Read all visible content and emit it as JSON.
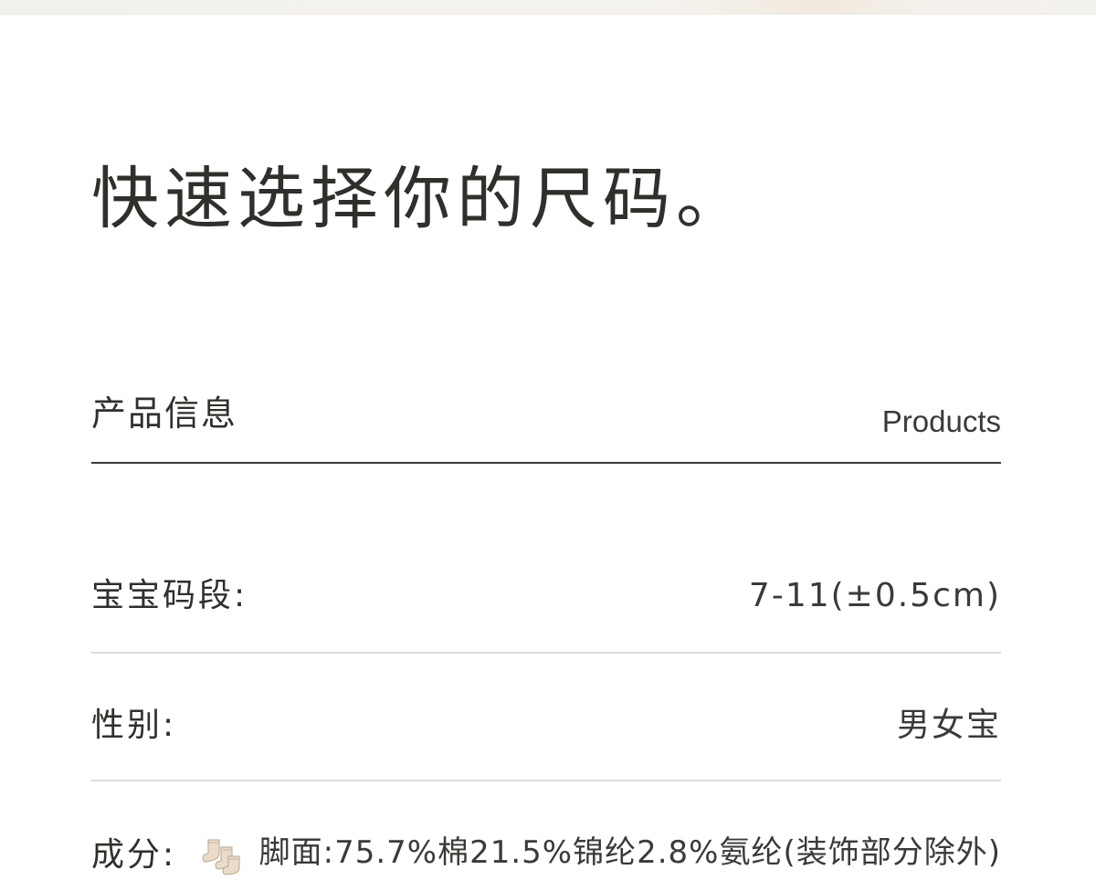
{
  "page": {
    "title": "快速选择你的尺码。"
  },
  "section": {
    "title_cn": "产品信息",
    "title_en": "Products"
  },
  "specs": [
    {
      "label": "宝宝码段:",
      "value": "7-11(±0.5cm)"
    },
    {
      "label": "性别:",
      "value": "男女宝"
    },
    {
      "label": "成分:",
      "icon": "sock-icon",
      "value": "脚面:75.7%棉21.5%锦纶2.8%氨纶(装饰部分除外)"
    }
  ],
  "colors": {
    "text": "#2f302b",
    "divider": "#dcdcd8",
    "header_rule": "#3a3b37"
  }
}
